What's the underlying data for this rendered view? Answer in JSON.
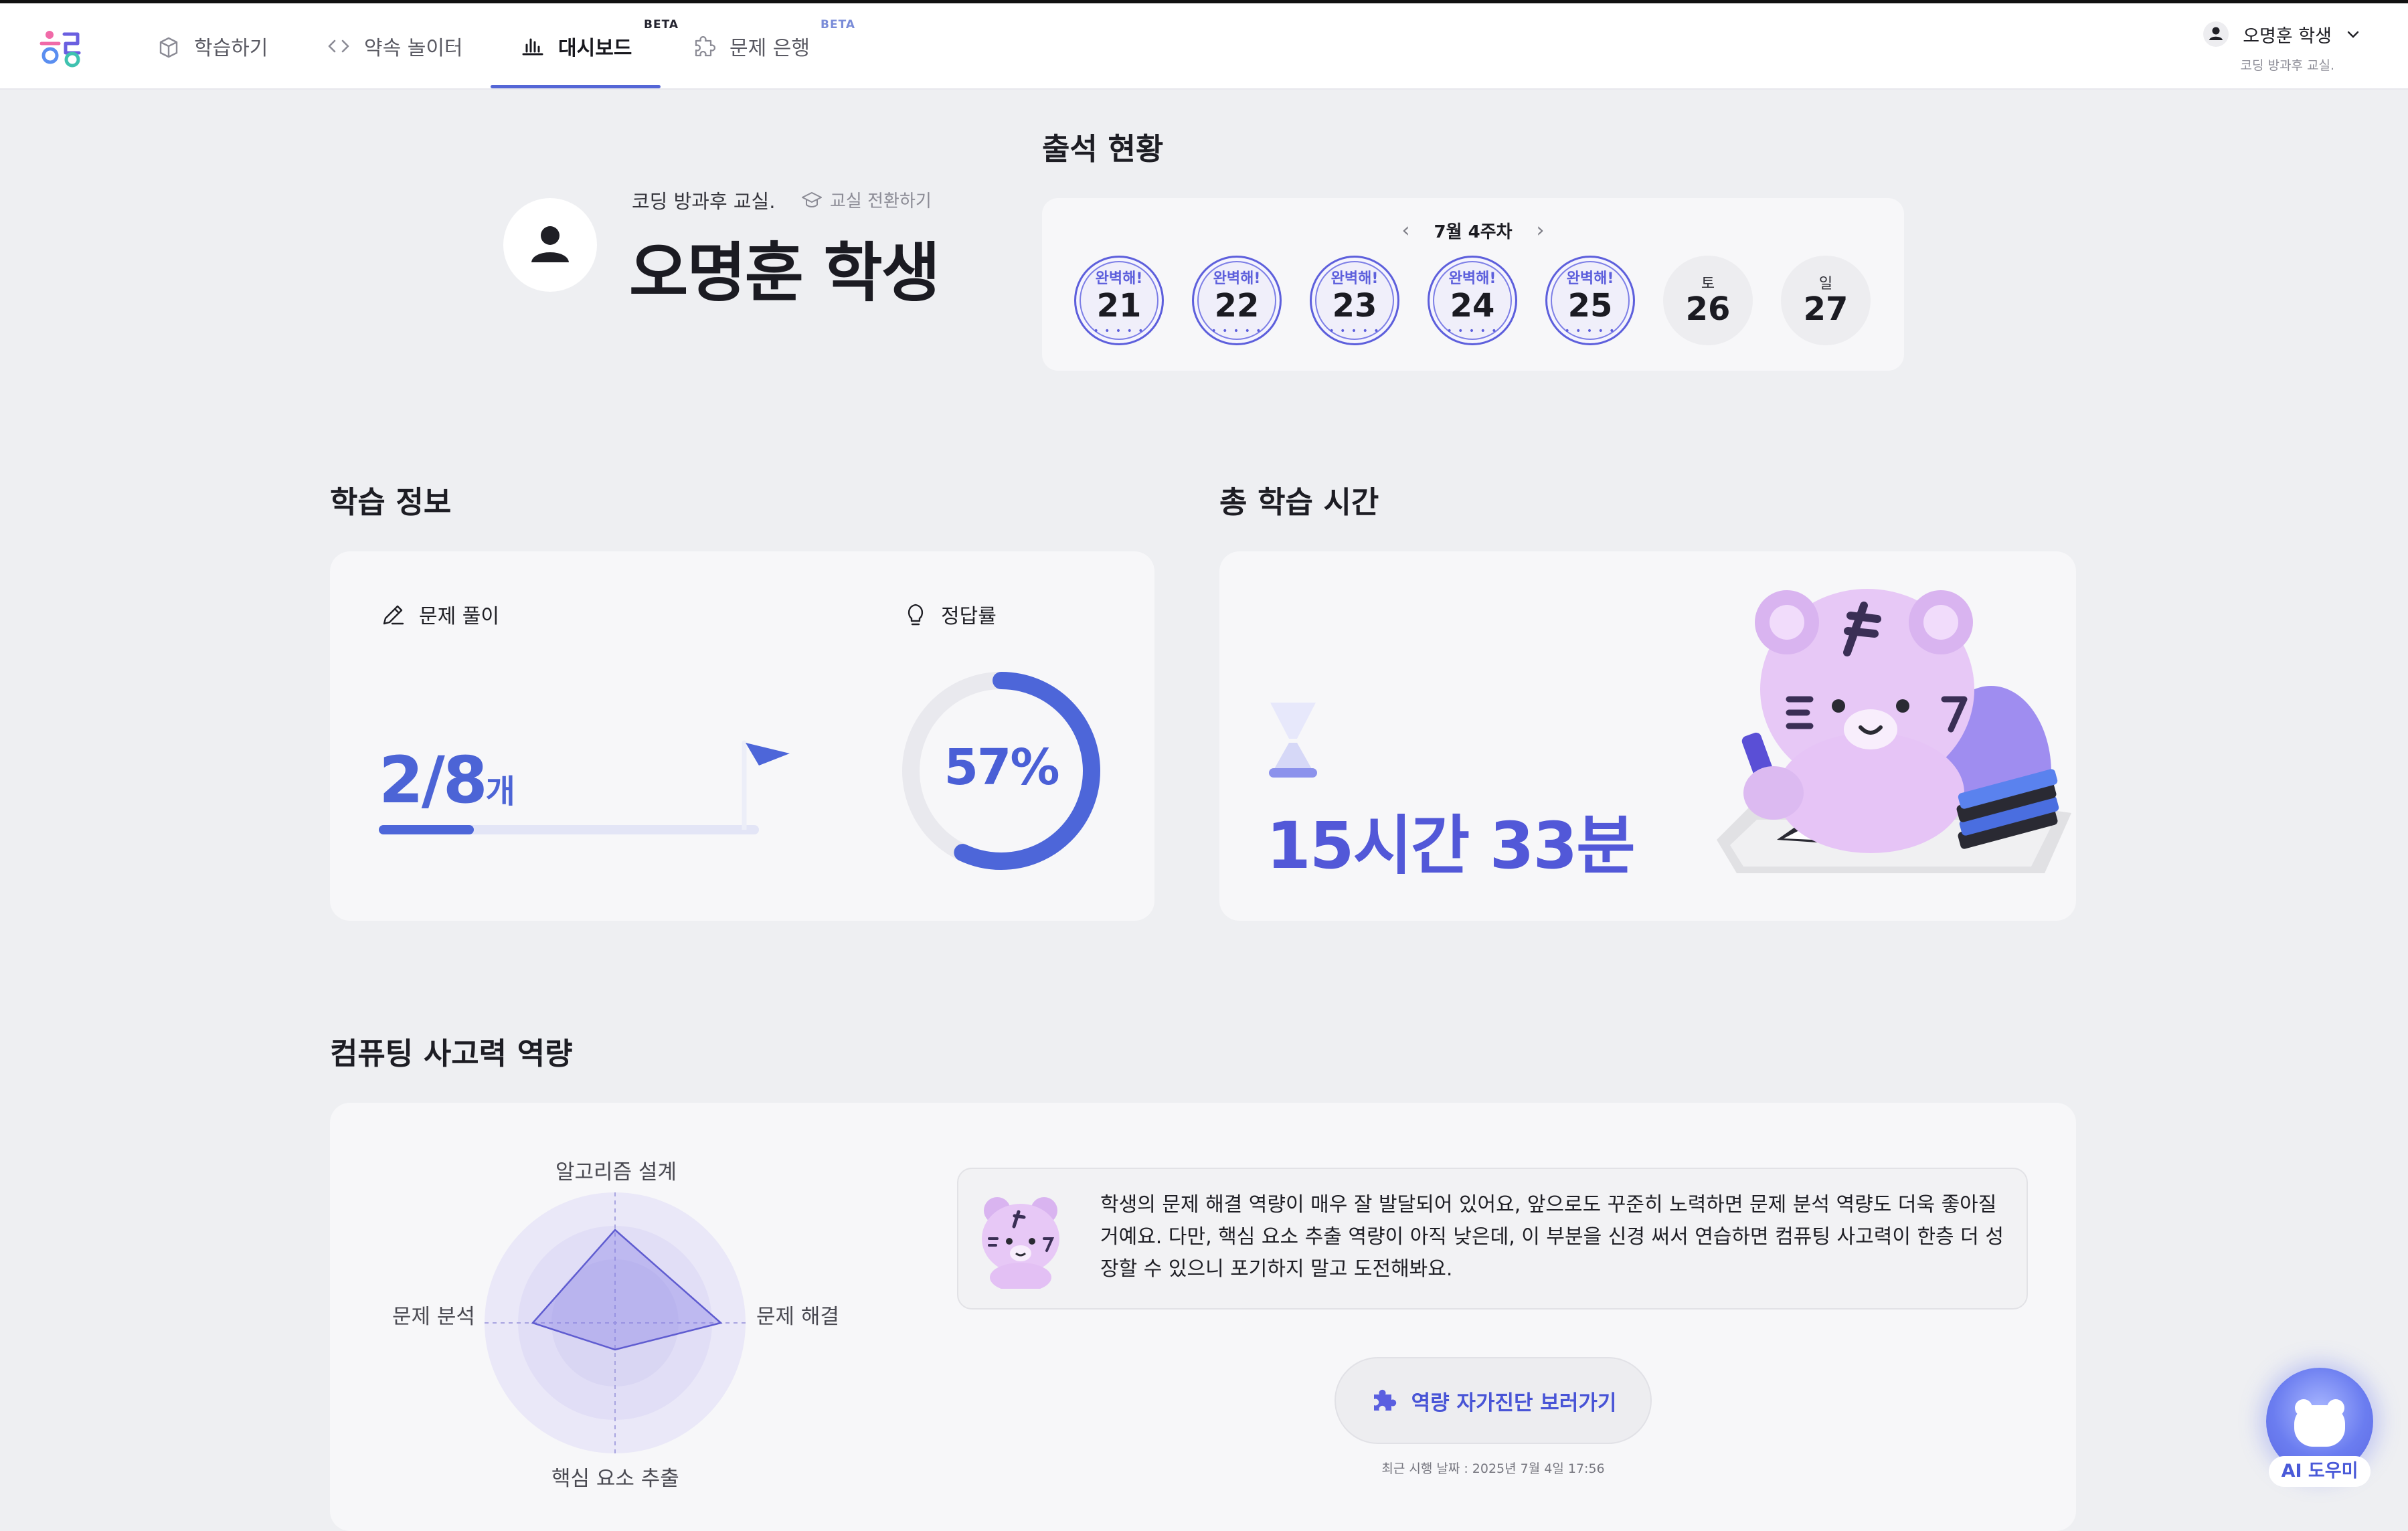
{
  "nav": {
    "items": [
      {
        "label": "학습하기",
        "icon": "study-icon"
      },
      {
        "label": "약속 놀이터",
        "icon": "code-brackets-icon"
      },
      {
        "label": "대시보드",
        "icon": "bar-chart-icon",
        "active": true,
        "badge": "BETA"
      },
      {
        "label": "문제 은행",
        "icon": "puzzle-icon",
        "badge": "BETA"
      }
    ],
    "user": {
      "name": "오명훈 학생",
      "classroom": "코딩 방과후 교실."
    }
  },
  "profile": {
    "classroom": "코딩 방과후 교실.",
    "switch_label": "교실 전환하기",
    "student_name": "오명훈 학생"
  },
  "attendance": {
    "title": "출석 현황",
    "week": "7월 4주차",
    "stamp_text": "완벽해!",
    "days": [
      {
        "day": "21",
        "attended": true
      },
      {
        "day": "22",
        "attended": true
      },
      {
        "day": "23",
        "attended": true
      },
      {
        "day": "24",
        "attended": true
      },
      {
        "day": "25",
        "attended": true
      },
      {
        "day": "26",
        "weekday": "토",
        "attended": false
      },
      {
        "day": "27",
        "weekday": "일",
        "attended": false
      }
    ]
  },
  "study_info": {
    "title": "학습 정보",
    "solved_label": "문제 풀이",
    "solved": "2/8",
    "solved_unit": "개",
    "solved_ratio": 0.25,
    "accuracy_label": "정답률",
    "accuracy": "57%",
    "accuracy_value": 57
  },
  "total_time": {
    "title": "총 학습 시간",
    "value": "15시간 33분"
  },
  "competency": {
    "title": "컴퓨팅 사고력 역량",
    "axes": {
      "top": "알고리즘 설계",
      "right": "문제 해결",
      "bottom": "핵심 요소 추출",
      "left": "문제 분석"
    },
    "comment": "학생의 문제 해결 역량이 매우 잘 발달되어 있어요, 앞으로도 꾸준히 노력하면 문제 분석 역량도 더욱 좋아질 거예요. 다만, 핵심 요소 추출 역량이 아직 낮은데, 이 부분을 신경 써서 연습하면 컴퓨팅 사고력이 한층 더 성장할 수 있으니 포기하지 말고 도전해봐요.",
    "button": "역량 자가진단 보러가기",
    "recent": "최근 시행 날짜 : 2025년 7월 4일 17:56"
  },
  "ai_helper": {
    "label": "AI 도우미"
  },
  "colors": {
    "accent": "#4d66d9",
    "purple": "#5258d8",
    "bg": "#eeeff2",
    "card": "#f7f7f9"
  }
}
